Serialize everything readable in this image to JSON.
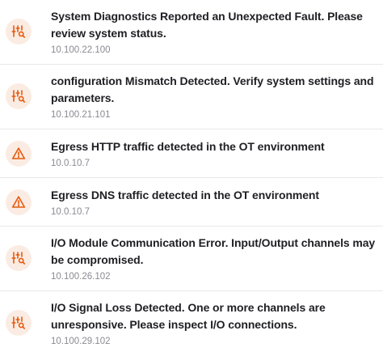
{
  "alerts": [
    {
      "title": "System Diagnostics Reported an Unexpected Fault. Please review system status.",
      "ip": "10.100.22.100",
      "icon": "sliders-search-icon"
    },
    {
      "title": "configuration Mismatch Detected. Verify system settings and parameters.",
      "ip": "10.100.21.101",
      "icon": "sliders-search-icon"
    },
    {
      "title": "Egress HTTP traffic detected in the OT environment",
      "ip": "10.0.10.7",
      "icon": "warning-triangle-icon"
    },
    {
      "title": "Egress DNS traffic detected in the OT environment",
      "ip": "10.0.10.7",
      "icon": "warning-triangle-icon"
    },
    {
      "title": "I/O Module Communication Error. Input/Output channels may be compromised.",
      "ip": "10.100.26.102",
      "icon": "sliders-search-icon"
    },
    {
      "title": "I/O Signal Loss Detected. One or more channels are unresponsive. Please inspect I/O connections.",
      "ip": "10.100.29.102",
      "icon": "sliders-search-icon"
    }
  ],
  "colors": {
    "icon_accent": "#e8590c",
    "icon_bg": "#fbece3",
    "title_text": "#1f1f24",
    "ip_text": "#8a8a92",
    "divider": "#e9e9ec"
  }
}
